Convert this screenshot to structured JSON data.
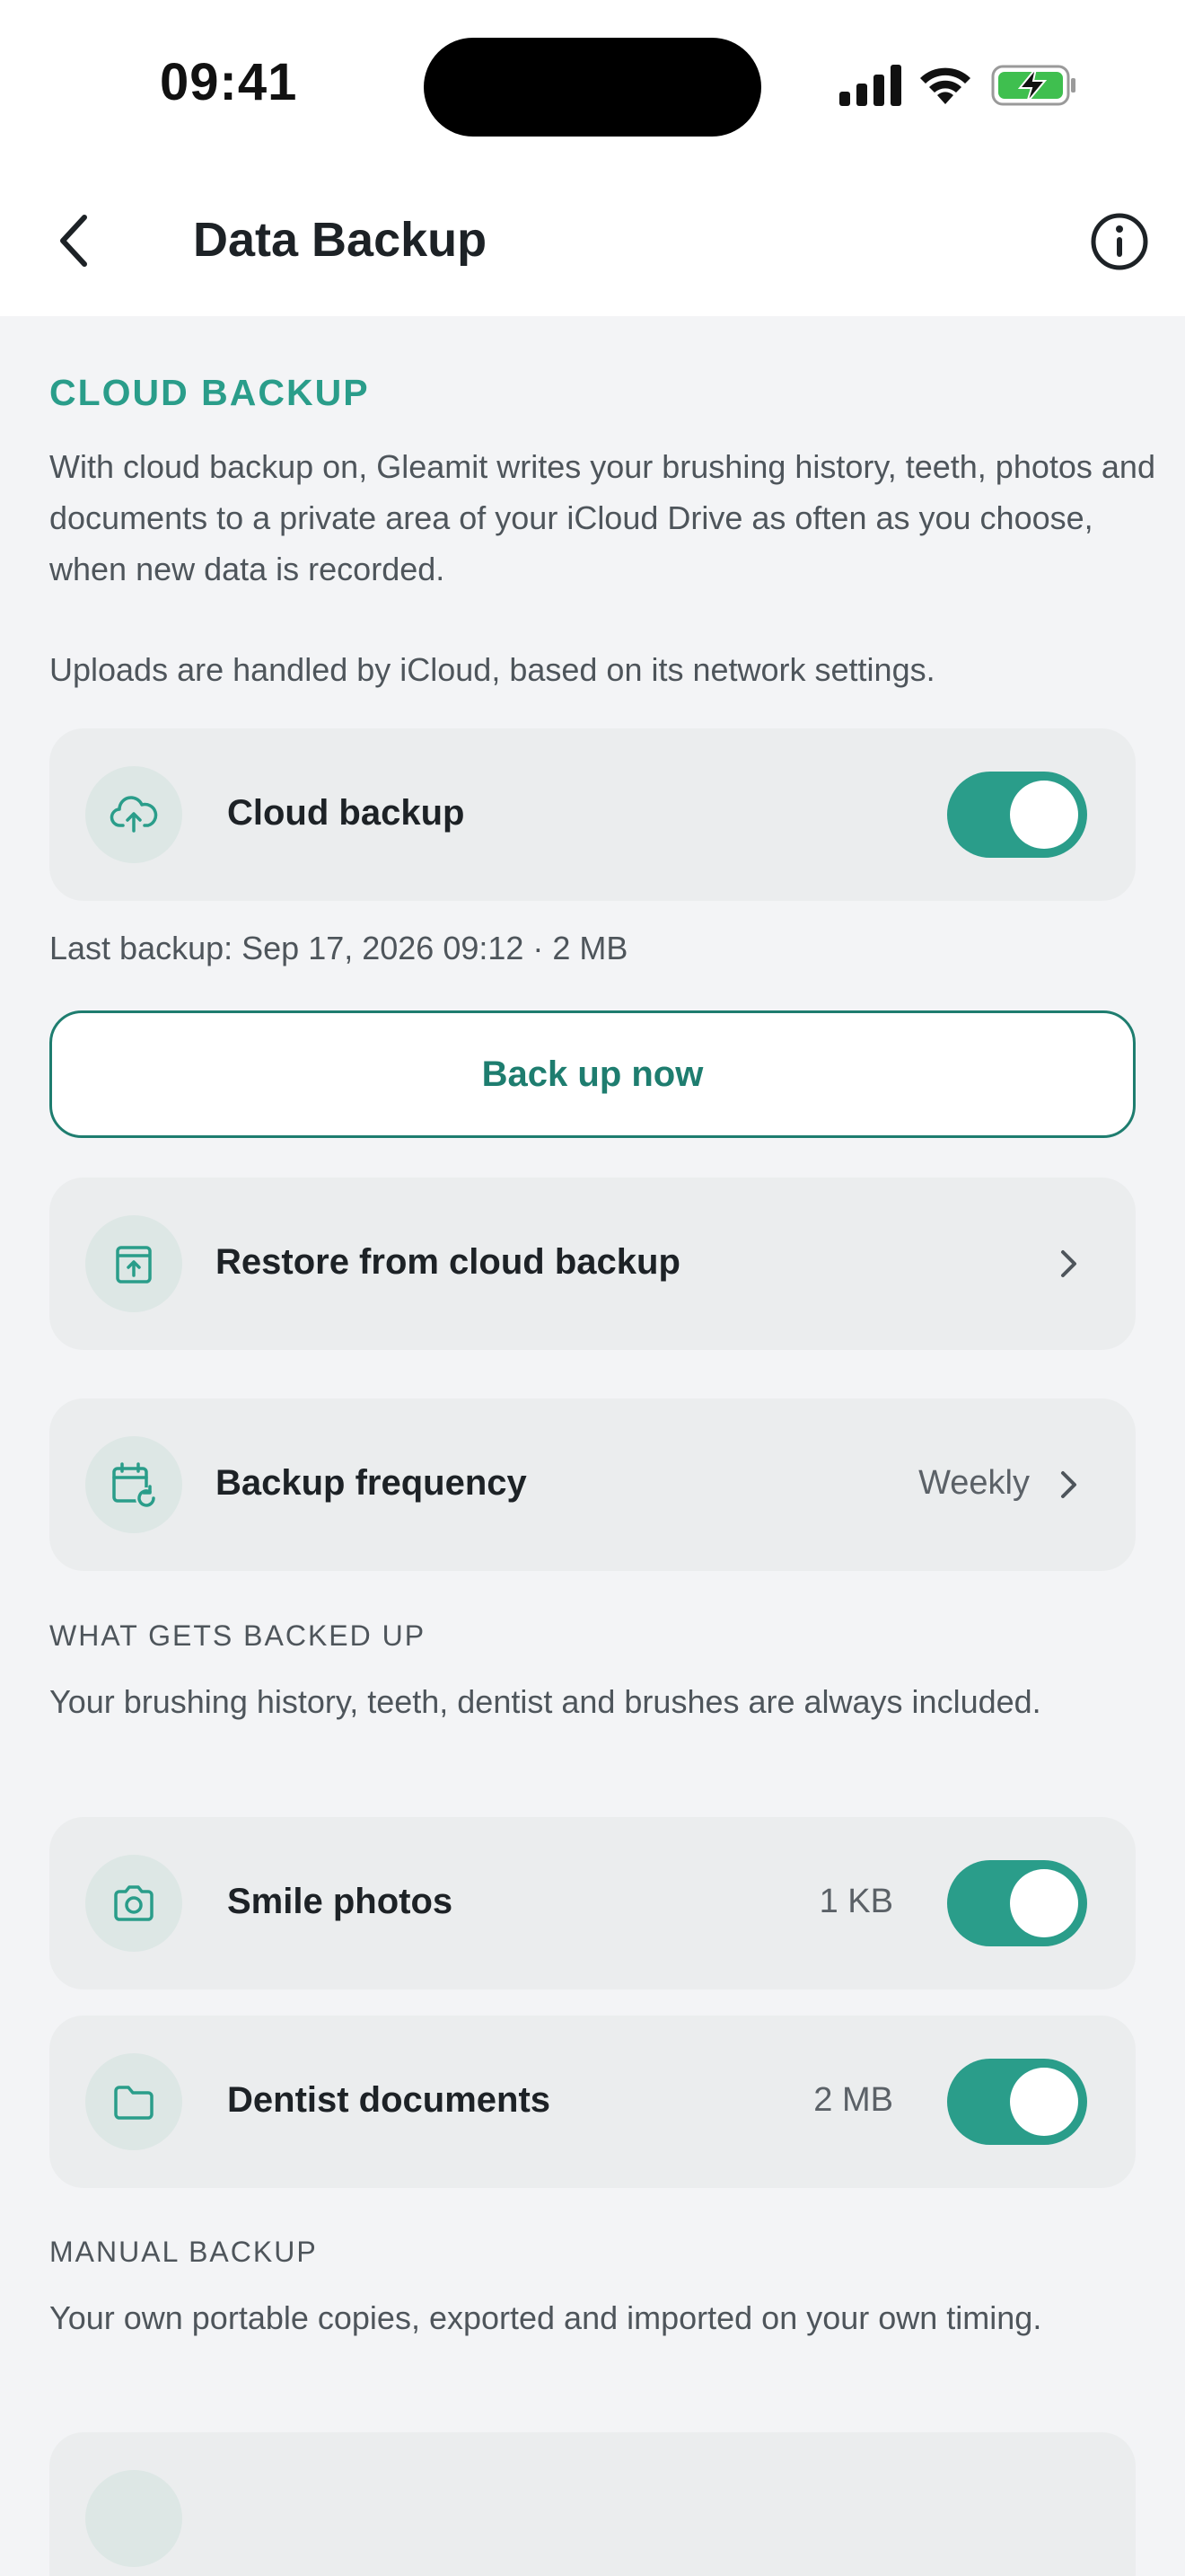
{
  "status_bar": {
    "time": "09:41"
  },
  "nav": {
    "title": "Data Backup"
  },
  "cloud_backup": {
    "section_title": "CLOUD BACKUP",
    "description": "With cloud backup on, Gleamit writes your brushing history, teeth, photos and documents to a private area of your iCloud Drive as often as you choose, when new data is recorded.",
    "network_note": "Uploads are handled by iCloud, based on its network settings.",
    "toggle_label": "Cloud backup",
    "toggle_on": true,
    "last_backup": "Last backup: Sep 17, 2026 09:12 · 2 MB",
    "backup_now_label": "Back up now",
    "restore_label": "Restore from cloud backup",
    "frequency_label": "Backup frequency",
    "frequency_value": "Weekly"
  },
  "what_gets_backed_up": {
    "header": "WHAT GETS BACKED UP",
    "description": "Your brushing history, teeth, dentist and brushes are always included.",
    "items": [
      {
        "label": "Smile photos",
        "size": "1 KB",
        "enabled": true,
        "icon": "camera-icon"
      },
      {
        "label": "Dentist documents",
        "size": "2 MB",
        "enabled": true,
        "icon": "folder-icon"
      }
    ]
  },
  "manual_backup": {
    "header": "MANUAL BACKUP",
    "description": "Your own portable copies, exported and imported on your own timing."
  },
  "colors": {
    "accent": "#2a9d8a",
    "accent_dark": "#1e7d6f",
    "card": "#ebedee",
    "background": "#f3f4f6"
  }
}
